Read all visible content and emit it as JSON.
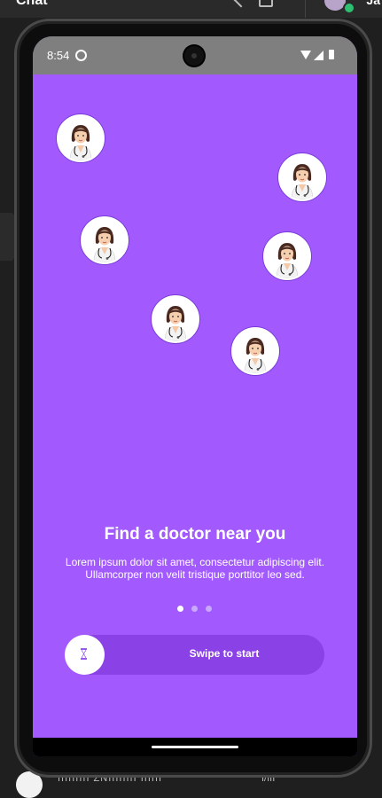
{
  "background_app": {
    "title": "Chat",
    "right_label": "Ja",
    "bottom_text": "IIIIIIIII ZNIIIIIIII IIIIII",
    "bottom_right": "I/III"
  },
  "status_bar": {
    "time": "8:54",
    "icons": [
      "settings-icon",
      "wifi-icon",
      "signal-icon",
      "battery-icon"
    ]
  },
  "onboarding": {
    "title": "Find a doctor near you",
    "description": "Lorem ipsum dolor sit amet, consectetur adipiscing elit. Ullamcorper non velit tristique porttitor leo sed.",
    "page_count": 3,
    "active_page": 0,
    "swipe_label": "Swipe to start",
    "swipe_icon": "hourglass-icon"
  },
  "colors": {
    "screen_bg": "#a25aff",
    "swipe_track": "#8a42e6",
    "status_bar": "#7f7f7f"
  }
}
